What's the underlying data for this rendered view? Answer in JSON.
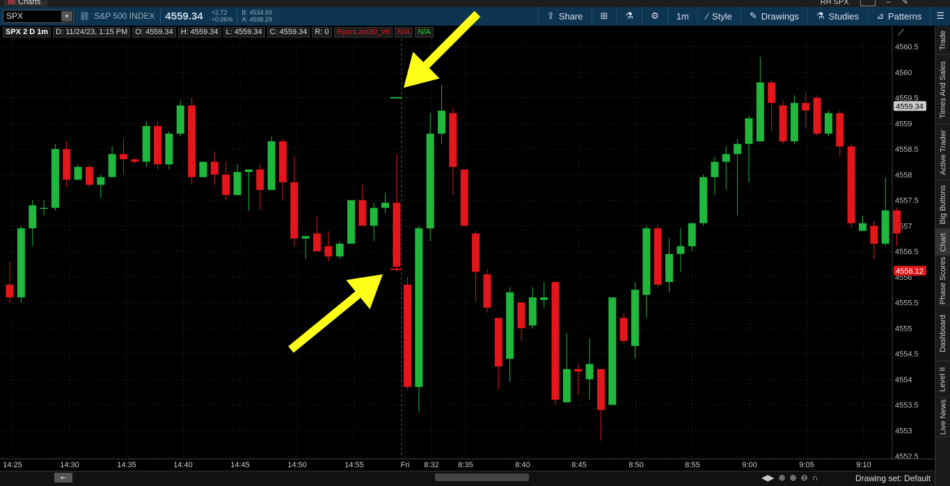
{
  "window": {
    "title": "Charts",
    "right_label": "RH SPX"
  },
  "header": {
    "symbol": "SPX",
    "index_name": "S&P 500 INDEX",
    "last": "4559.34",
    "net_change": "+2.72",
    "pct_change": "+0.06%",
    "bid": "B: 4534.69",
    "ask": "A: 4598.29",
    "buttons": {
      "share": "Share",
      "timeframe": "1m",
      "style": "Style",
      "drawings": "Drawings",
      "studies": "Studies",
      "patterns": "Patterns"
    }
  },
  "infobar": {
    "aggregation": "SPX 2 D 1m",
    "date": "D: 11/24/23, 1:15 PM",
    "open": "O: 4559.34",
    "high": "H: 4559.34",
    "low": "L: 4559.34",
    "close": "C: 4559.34",
    "range": "R: 0",
    "study": "RyanLast30_v6",
    "study_val1": "N/A",
    "study_val2": "N/A"
  },
  "colors": {
    "up": "#1fb83d",
    "down": "#e3161b",
    "arrow": "#ffff19",
    "grid": "#3a3a3a",
    "header_bg": "#0d3552"
  },
  "chart_data": {
    "type": "candlestick",
    "ylim": [
      4552.5,
      4560.75
    ],
    "y_ticks": [
      4552.5,
      4553,
      4553.5,
      4554,
      4554.5,
      4555,
      4555.5,
      4556,
      4556.5,
      4557,
      4557.5,
      4558,
      4558.5,
      4559,
      4559.5,
      4560,
      4560.5
    ],
    "x_tick_labels": [
      "14:25",
      "14:30",
      "14:35",
      "14:40",
      "14:45",
      "14:50",
      "14:55",
      "Fri",
      "8:32",
      "8:35",
      "8:40",
      "8:45",
      "8:50",
      "8:55",
      "9:00",
      "9:05",
      "9:10"
    ],
    "price_labels": {
      "current": "4559.34",
      "marker": "4556.12"
    },
    "session_marker": "Fri",
    "candles_day1": [
      [
        4555.85,
        4555.6,
        4555.5,
        4556.3
      ],
      [
        4555.6,
        4556.95,
        4555.5,
        4557.0
      ],
      [
        4556.95,
        4557.4,
        4556.6,
        4557.5
      ],
      [
        4557.35,
        4557.35,
        4557.2,
        4557.5
      ],
      [
        4557.35,
        4558.5,
        4557.3,
        4558.6
      ],
      [
        4558.5,
        4557.9,
        4557.75,
        4558.65
      ],
      [
        4557.9,
        4558.15,
        4557.9,
        4558.2
      ],
      [
        4558.15,
        4557.8,
        4557.75,
        4558.2
      ],
      [
        4557.8,
        4557.95,
        4557.55,
        4558.0
      ],
      [
        4557.95,
        4558.4,
        4557.95,
        4558.55
      ],
      [
        4558.4,
        4558.3,
        4558.0,
        4558.7
      ],
      [
        4558.3,
        4558.25,
        4558.2,
        4558.3
      ],
      [
        4558.25,
        4558.95,
        4558.15,
        4559.05
      ],
      [
        4558.95,
        4558.2,
        4558.1,
        4559.05
      ],
      [
        4558.2,
        4558.8,
        4558.1,
        4558.85
      ],
      [
        4558.8,
        4559.35,
        4558.75,
        4559.45
      ],
      [
        4559.35,
        4557.95,
        4557.8,
        4559.5
      ],
      [
        4557.95,
        4558.25,
        4558.0,
        4558.25
      ],
      [
        4558.25,
        4558.0,
        4557.8,
        4558.45
      ],
      [
        4558.0,
        4557.6,
        4557.5,
        4558.25
      ],
      [
        4557.6,
        4558.05,
        4557.6,
        4558.2
      ],
      [
        4558.05,
        4558.1,
        4557.3,
        4558.1
      ],
      [
        4558.1,
        4557.7,
        4557.3,
        4558.2
      ],
      [
        4557.7,
        4558.65,
        4557.7,
        4558.75
      ],
      [
        4558.65,
        4557.85,
        4557.5,
        4558.7
      ],
      [
        4557.85,
        4556.75,
        4556.6,
        4558.35
      ],
      [
        4556.75,
        4556.8,
        4556.35,
        4556.8
      ],
      [
        4556.85,
        4556.5,
        4556.5,
        4557.2
      ],
      [
        4556.6,
        4556.4,
        4556.3,
        4556.9
      ],
      [
        4556.4,
        4556.65,
        4556.35,
        4556.7
      ],
      [
        4556.65,
        4557.5,
        4556.65,
        4557.5
      ],
      [
        4557.5,
        4557.0,
        4557.0,
        4557.8
      ],
      [
        4557.0,
        4557.35,
        4556.7,
        4557.45
      ],
      [
        4557.35,
        4557.45,
        4557.25,
        4557.65
      ],
      [
        4557.45,
        4556.2,
        4556.1,
        4558.4
      ]
    ],
    "candles_day2": [
      [
        4555.85,
        4553.85,
        4553.8,
        4556.0
      ],
      [
        4553.85,
        4556.95,
        4553.35,
        4557.0
      ],
      [
        4556.95,
        4558.8,
        4556.7,
        4559.2
      ],
      [
        4558.8,
        4559.25,
        4558.6,
        4559.75
      ],
      [
        4559.2,
        4558.15,
        4557.6,
        4559.3
      ],
      [
        4558.1,
        4557.0,
        4557.0,
        4558.1
      ],
      [
        4556.85,
        4556.1,
        4555.5,
        4556.9
      ],
      [
        4556.05,
        4555.4,
        4555.3,
        4556.15
      ],
      [
        4555.2,
        4554.25,
        4553.8,
        4555.2
      ],
      [
        4554.4,
        4555.7,
        4553.95,
        4555.8
      ],
      [
        4555.5,
        4555.0,
        4554.75,
        4555.5
      ],
      [
        4555.05,
        4555.6,
        4555.0,
        4555.8
      ],
      [
        4555.55,
        4555.6,
        4555.4,
        4555.9
      ],
      [
        4555.9,
        4553.6,
        4553.5,
        4555.9
      ],
      [
        4553.55,
        4554.2,
        4553.55,
        4554.9
      ],
      [
        4554.2,
        4554.15,
        4553.7,
        4554.3
      ],
      [
        4554.0,
        4554.3,
        4553.6,
        4554.8
      ],
      [
        4554.2,
        4553.4,
        4552.8,
        4554.2
      ],
      [
        4553.5,
        4555.6,
        4553.5,
        4555.6
      ],
      [
        4555.2,
        4554.75,
        4554.7,
        4555.3
      ],
      [
        4554.65,
        4555.75,
        4554.4,
        4555.9
      ],
      [
        4555.65,
        4556.95,
        4555.2,
        4557.0
      ],
      [
        4556.95,
        4555.85,
        4555.8,
        4557.0
      ],
      [
        4555.9,
        4556.45,
        4555.7,
        4556.75
      ],
      [
        4556.45,
        4556.6,
        4556.1,
        4556.95
      ],
      [
        4556.6,
        4557.05,
        4556.5,
        4557.05
      ],
      [
        4557.05,
        4557.95,
        4557.0,
        4558.0
      ],
      [
        4557.95,
        4558.25,
        4557.6,
        4558.35
      ],
      [
        4558.25,
        4558.4,
        4557.7,
        4558.55
      ],
      [
        4558.4,
        4558.6,
        4557.2,
        4558.7
      ],
      [
        4558.6,
        4559.1,
        4557.85,
        4559.15
      ],
      [
        4558.65,
        4559.8,
        4558.65,
        4560.3
      ],
      [
        4559.8,
        4559.4,
        4558.85,
        4559.85
      ],
      [
        4559.35,
        4558.65,
        4558.6,
        4559.45
      ],
      [
        4558.65,
        4559.4,
        4558.6,
        4559.55
      ],
      [
        4559.4,
        4559.25,
        4558.9,
        4559.6
      ],
      [
        4559.5,
        4558.8,
        4558.75,
        4559.55
      ],
      [
        4558.8,
        4559.2,
        4558.75,
        4559.25
      ],
      [
        4559.2,
        4558.55,
        4558.35,
        4559.25
      ],
      [
        4558.55,
        4557.05,
        4556.95,
        4558.6
      ],
      [
        4556.9,
        4557.05,
        4556.9,
        4557.2
      ],
      [
        4557.0,
        4556.65,
        4556.35,
        4557.1
      ],
      [
        4556.65,
        4557.3,
        4556.6,
        4557.95
      ],
      [
        4557.3,
        4556.85,
        4556.6,
        4557.35
      ]
    ],
    "study_markers": [
      {
        "session": "day1",
        "value": 4559.5,
        "color": "up"
      },
      {
        "session": "day1",
        "value": 4556.15,
        "color": "down"
      }
    ],
    "annotations": [
      "yellow-arrow-to-upper-marker",
      "yellow-arrow-to-lower-marker"
    ]
  },
  "right_tabs": [
    "Trade",
    "Times And Sales",
    "Active Trader",
    "Big Buttons",
    "Chart",
    "Phase Scores",
    "Dashboard",
    "Level II",
    "Live News"
  ],
  "right_tabs_active": "Chart",
  "bottom": {
    "drawing_set": "Drawing set: Default"
  }
}
